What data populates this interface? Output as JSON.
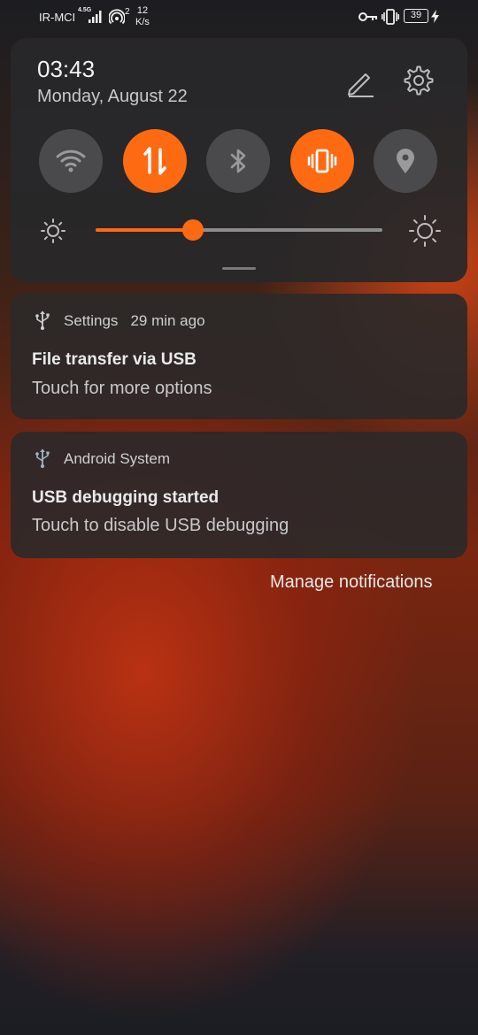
{
  "status_bar": {
    "carrier": "IR-MCI",
    "network_type": "4.5G",
    "hotspot_count": "2",
    "speed_value": "12",
    "speed_unit": "K/s",
    "battery": "39",
    "icons": [
      "signal-icon",
      "hotspot-icon",
      "vpn-key-icon",
      "vibrate-icon",
      "battery-icon",
      "charging-icon"
    ]
  },
  "quick_settings": {
    "time": "03:43",
    "date": "Monday, August 22",
    "tiles": [
      {
        "name": "wifi",
        "active": false
      },
      {
        "name": "mobile-data",
        "active": true
      },
      {
        "name": "bluetooth",
        "active": false
      },
      {
        "name": "vibrate",
        "active": true
      },
      {
        "name": "location",
        "active": false
      }
    ],
    "brightness_fraction": 0.34,
    "accent_color": "#fe6a12"
  },
  "notifications": [
    {
      "app": "Settings",
      "time": "29 min ago",
      "title": "File transfer via USB",
      "body": "Touch for more options",
      "icon": "usb-icon"
    },
    {
      "app": "Android System",
      "time": "",
      "title": "USB debugging started",
      "body": "Touch to disable USB debugging",
      "icon": "usb-icon"
    }
  ],
  "manage_label": "Manage notifications"
}
